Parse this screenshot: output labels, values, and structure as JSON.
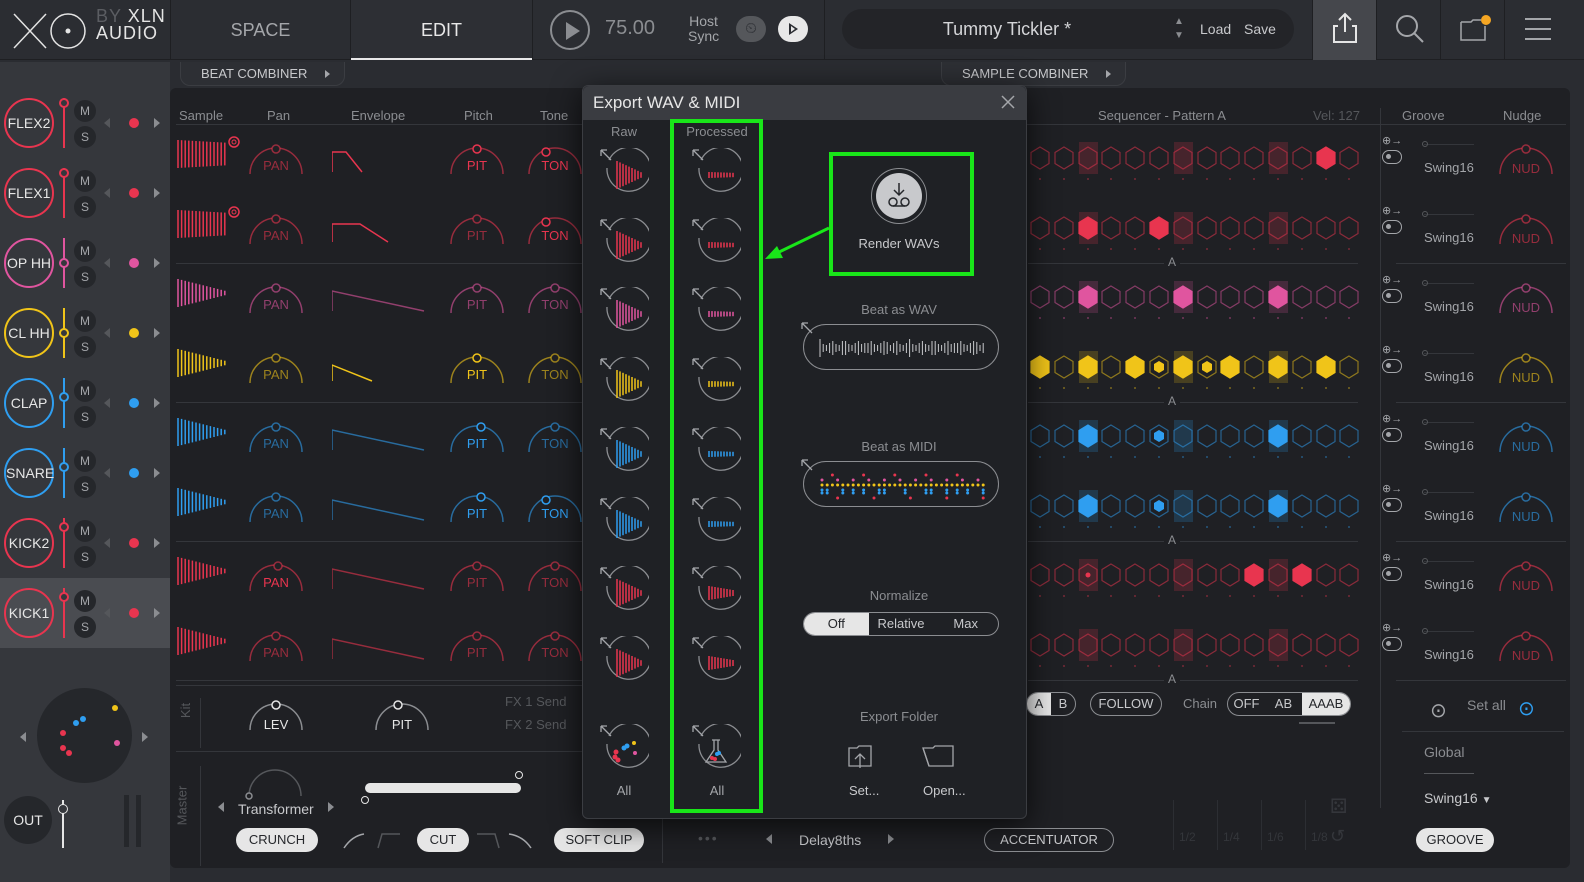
{
  "app": {
    "logo": {
      "by": "BY",
      "brand_line1": "XLN",
      "brand_line2": "AUDIO"
    },
    "tabs": [
      {
        "label": "SPACE",
        "active": false
      },
      {
        "label": "EDIT",
        "active": true
      }
    ],
    "transport": {
      "tempo": "75.00",
      "host_sync_line1": "Host",
      "host_sync_line2": "Sync"
    },
    "preset": {
      "name": "Tummy Tickler *",
      "load": "Load",
      "save": "Save"
    },
    "top_icons": [
      "export-icon",
      "search-icon",
      "folder-icon",
      "menu-icon"
    ],
    "folder_badge_color": "#f5a623"
  },
  "combiners": {
    "beat": "BEAT COMBINER",
    "sample": "SAMPLE COMBINER"
  },
  "columns": {
    "sample": "Sample",
    "pan": "Pan",
    "envelope": "Envelope",
    "pitch": "Pitch",
    "tone": "Tone",
    "sequencer": "Sequencer - Pattern A",
    "velocity": "Vel: 127",
    "groove": "Groove",
    "nudge": "Nudge"
  },
  "tracks": [
    {
      "name": "FLEX2",
      "color": "#e8354f",
      "mute": "M",
      "solo": "S",
      "pan": "PAN",
      "pitch": "PIT",
      "tone": "TON",
      "swing": "Swing16",
      "nudge": "NUD",
      "steps": [
        0,
        0,
        0,
        0,
        0,
        0,
        0,
        0,
        0,
        0,
        0,
        0,
        1,
        0
      ]
    },
    {
      "name": "FLEX1",
      "color": "#e8354f",
      "mute": "M",
      "solo": "S",
      "pan": "PAN",
      "pitch": "PIT",
      "tone": "TON",
      "swing": "Swing16",
      "nudge": "NUD",
      "steps": [
        0,
        0,
        1,
        0,
        0,
        1,
        0,
        0,
        0,
        0,
        0,
        0,
        0,
        0
      ]
    },
    {
      "name": "OP HH",
      "color": "#e0559f",
      "mute": "M",
      "solo": "S",
      "pan": "PAN",
      "pitch": "PIT",
      "tone": "TON",
      "swing": "Swing16",
      "nudge": "NUD",
      "steps": [
        0,
        0,
        1,
        0,
        0,
        0,
        1,
        0,
        0,
        0,
        1,
        0,
        0,
        0
      ]
    },
    {
      "name": "CL HH",
      "color": "#f0c419",
      "mute": "M",
      "solo": "S",
      "pan": "PAN",
      "pitch": "PIT",
      "tone": "TON",
      "swing": "Swing16",
      "nudge": "NUD",
      "steps": [
        1,
        0,
        1,
        0,
        1,
        0.5,
        1,
        0.5,
        1,
        0,
        1,
        0,
        1,
        0
      ]
    },
    {
      "name": "CLAP",
      "color": "#2f9ef0",
      "mute": "M",
      "solo": "S",
      "pan": "PAN",
      "pitch": "PIT",
      "tone": "TON",
      "swing": "Swing16",
      "nudge": "NUD",
      "steps": [
        0,
        0,
        1,
        0,
        0,
        0.6,
        0,
        0,
        0,
        0,
        1,
        0,
        0,
        0
      ]
    },
    {
      "name": "SNARE",
      "color": "#2f9ef0",
      "mute": "M",
      "solo": "S",
      "pan": "PAN",
      "pitch": "PIT",
      "tone": "TON",
      "swing": "Swing16",
      "nudge": "NUD",
      "steps": [
        0,
        0,
        1,
        0,
        0,
        0.6,
        0,
        0,
        0,
        0,
        1,
        0,
        0,
        0
      ]
    },
    {
      "name": "KICK2",
      "color": "#e8354f",
      "mute": "M",
      "solo": "S",
      "pan": "PAN",
      "pitch": "PIT",
      "tone": "TON",
      "swing": "Swing16",
      "nudge": "NUD",
      "steps": [
        0,
        0,
        0.2,
        0,
        0,
        0,
        0,
        0,
        0,
        0.8,
        0,
        0.8,
        0,
        0
      ]
    },
    {
      "name": "KICK1",
      "color": "#e8354f",
      "mute": "M",
      "solo": "S",
      "pan": "PAN",
      "pitch": "PIT",
      "tone": "TON",
      "swing": "Swing16",
      "nudge": "NUD",
      "steps": [
        0,
        0,
        0,
        0,
        0,
        0,
        0,
        0,
        0,
        0,
        0,
        0,
        0,
        0
      ],
      "selected": true
    }
  ],
  "pattern_marker": "A",
  "kit": {
    "label": "Kit",
    "lev": "LEV",
    "pit": "PIT",
    "fx1": "FX 1 Send",
    "fx2": "FX 2 Send"
  },
  "master": {
    "label": "Master",
    "effect": "Transformer",
    "crunch": "CRUNCH",
    "cut": "CUT",
    "soft_clip": "SOFT CLIP",
    "delay": "Delay8ths"
  },
  "out_label": "OUT",
  "pattern_controls": {
    "a": "A",
    "b": "B",
    "follow": "FOLLOW",
    "chain": "Chain",
    "chain_options": [
      "OFF",
      "AB",
      "AAAB"
    ],
    "chain_selected": "AAAB",
    "accentuator": "ACCENTUATOR",
    "divisions": [
      "1/2",
      "1/4",
      "1/6",
      "1/8"
    ]
  },
  "groove": {
    "set_all": "Set all",
    "global": "Global",
    "global_swing": "Swing16",
    "button": "GROOVE"
  },
  "dialog": {
    "title": "Export WAV & MIDI",
    "raw_label": "Raw",
    "processed_label": "Processed",
    "all_label": "All",
    "render_wavs": "Render WAVs",
    "beat_as_wav": "Beat as WAV",
    "beat_as_midi": "Beat as MIDI",
    "normalize": "Normalize",
    "normalize_options": [
      "Off",
      "Relative",
      "Max"
    ],
    "normalize_selected": "Off",
    "export_folder": "Export Folder",
    "set": "Set...",
    "open": "Open..."
  },
  "annotation": {
    "highlight_color": "#19e619"
  }
}
